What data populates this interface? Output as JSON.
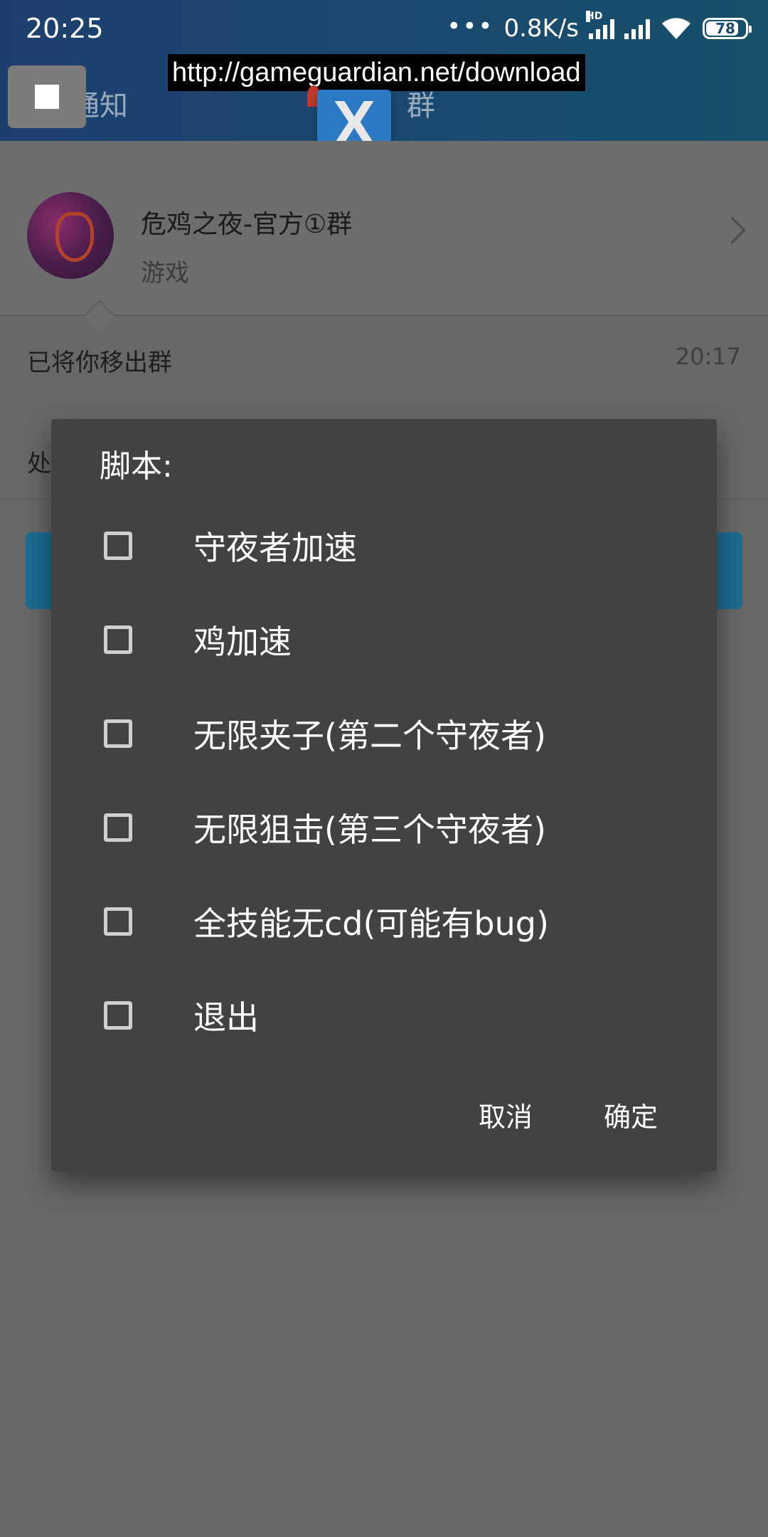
{
  "status_bar": {
    "time": "20:25",
    "dots": "•••",
    "net_speed": "0.8K/s",
    "hd_label": "HD",
    "battery": "78"
  },
  "header": {
    "tab_left": "通知",
    "tab_right": "群",
    "overlay_url": "http://gameguardian.net/download",
    "floating_icon_letter": "X"
  },
  "group": {
    "name": "危鸡之夜-官方①群",
    "type": "游戏"
  },
  "message": {
    "text": "已将你移出群",
    "time": "20:17",
    "partial_text": "处"
  },
  "dialog": {
    "title": "脚本:",
    "options": [
      {
        "label": "守夜者加速",
        "checked": false
      },
      {
        "label": "鸡加速",
        "checked": false
      },
      {
        "label": "无限夹子(第二个守夜者)",
        "checked": false
      },
      {
        "label": "无限狙击(第三个守夜者)",
        "checked": false
      },
      {
        "label": "全技能无cd(可能有bug)",
        "checked": false
      },
      {
        "label": "退出",
        "checked": false
      }
    ],
    "cancel_label": "取消",
    "confirm_label": "确定"
  },
  "colors": {
    "header_gradient_start": "#1d3f6e",
    "header_gradient_end": "#16506a",
    "dialog_bg": "#424242",
    "scrim": "#686868",
    "floating_icon": "#2b79c5"
  }
}
